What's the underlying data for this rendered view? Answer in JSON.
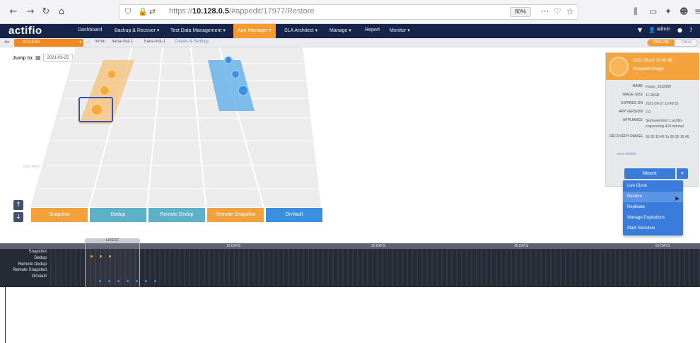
{
  "browser": {
    "url_prefix": "https://",
    "url_host": "10.128.0.5",
    "url_path": "/#appedit/17977/Restore",
    "zoom": "80%"
  },
  "nav": {
    "logo": "actifio",
    "menu": [
      "Dashboard",
      "Backup & Recover ▾",
      "Test Data Management ▾",
      "App Manager ▾",
      "SLA Architect ▾",
      "Manage ▾",
      "Report",
      "Monitor ▾"
    ],
    "active_index": 3,
    "user": "admin"
  },
  "subbar": {
    "app_select": "ACCESS",
    "crumbs": [
      "mmm",
      "hana-inst-1",
      "hana-inst-1"
    ],
    "details_link": "Details & Settings",
    "toggle_on": "TIMELINE",
    "toggle_off": "TABLE"
  },
  "jump": {
    "label": "Jump to:",
    "date": "2021-06-25"
  },
  "grid": {
    "date_label": "2021-06-27",
    "columns": [
      "Snapshot",
      "Dedup",
      "Remote Dedup",
      "Remote Snapshot",
      "OnVault"
    ],
    "column_colors": [
      "#f2a23d",
      "#5cb0c8",
      "#5cb0c8",
      "#f2a23d",
      "#3b8fe0"
    ]
  },
  "detail": {
    "title": "2021-06-25 10:43:46",
    "subtitle": "Snapshot Image",
    "rows": [
      {
        "key": "NAME",
        "value": "Image_1632980"
      },
      {
        "key": "IMAGE SIZE",
        "value": "11.00GB"
      },
      {
        "key": "EXPIRES ON",
        "value": "2021-06-27 10:49:55"
      },
      {
        "key": "APP VERSION",
        "value": "2.0"
      },
      {
        "key": "APPLIANCE",
        "value": "Skyhawentos7.c.actifio-engineering-410.internal"
      },
      {
        "key": "RECOVERY RANGE",
        "value": "06-25 10:46 To 06-25 10:46"
      }
    ],
    "more_details": "more details",
    "mount_label": "Mount",
    "mount_caret": "▾"
  },
  "dropdown": {
    "items": [
      "Live Clone",
      "Restore",
      "Replicate",
      "Manage Expirations",
      "Mark Sensitive"
    ],
    "hover_index": 1
  },
  "timeline": {
    "labels": [
      "Snapshot",
      "Dedup",
      "Remote Dedup",
      "Remote Snapshot",
      "OnVault"
    ],
    "window_label": "LATEST",
    "ticks": [
      "15 DAYS",
      "30 DAYS",
      "45 DAYS",
      "60 DAYS"
    ],
    "snapshot_color": "#f2a23d",
    "onvault_color": "#3b8fe0"
  }
}
